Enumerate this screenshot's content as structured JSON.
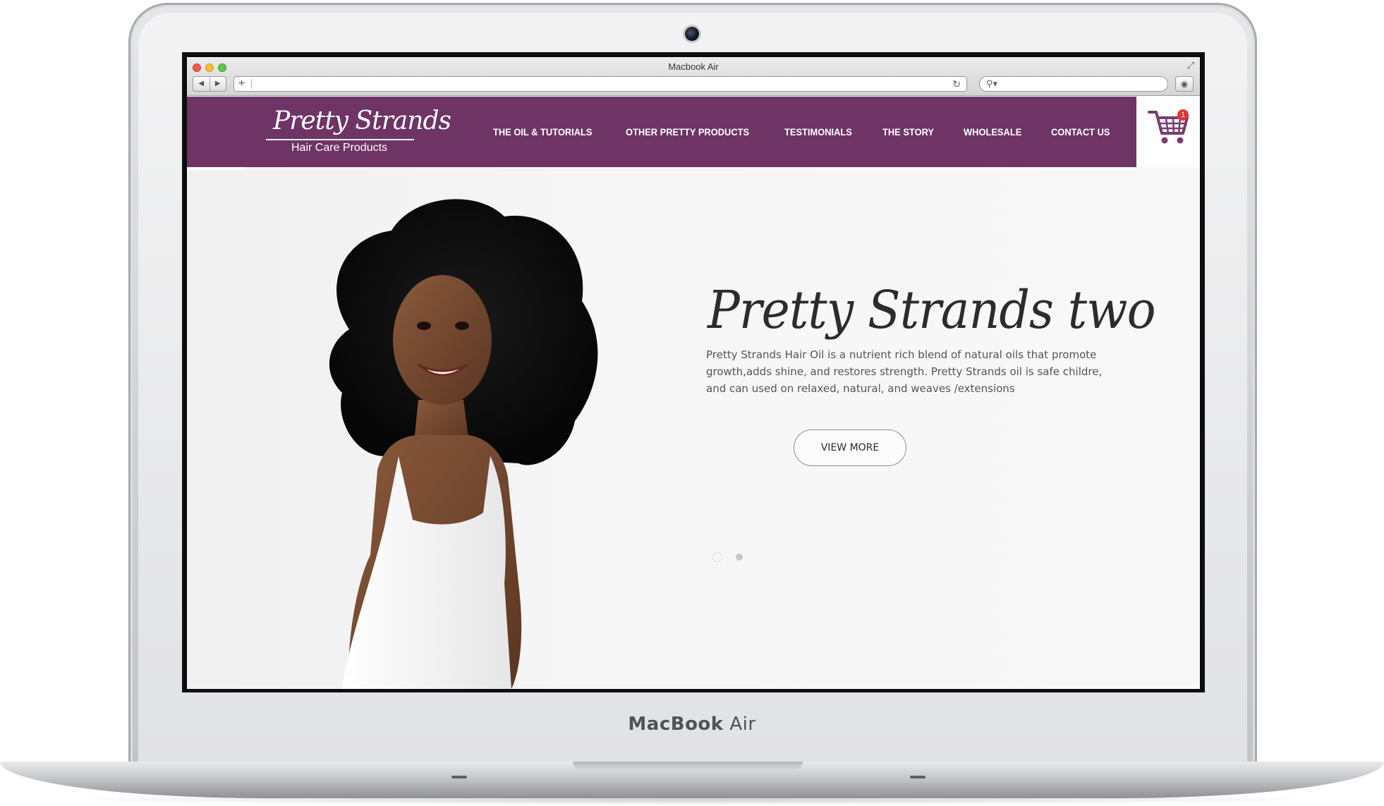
{
  "device": {
    "brand_bold": "MacBook",
    "brand_light": "Air"
  },
  "browser": {
    "window_title": "Macbook Air",
    "back_icon": "◀",
    "forward_icon": "▶",
    "new_tab_label": "+",
    "address_value": "",
    "search_value": ""
  },
  "site": {
    "logo": {
      "script": "Pretty Strands",
      "subtitle": "Hair Care Products"
    },
    "nav": [
      {
        "label": "THE OIL & TUTORIALS"
      },
      {
        "label": "OTHER PRETTY PRODUCTS"
      },
      {
        "label": "TESTIMONIALS"
      },
      {
        "label": "THE STORY"
      },
      {
        "label": "WHOLESALE"
      },
      {
        "label": "CONTACT US"
      }
    ],
    "cart": {
      "count": "1"
    },
    "colors": {
      "header_bg": "#6e3466",
      "cart_icon": "#7a3b73",
      "badge": "#e8322f"
    }
  },
  "hero": {
    "title": "Pretty Strands two",
    "description": "Pretty Strands Hair Oil is a nutrient rich blend of natural oils that promote growth,adds shine, and restores strength. Pretty Strands oil is safe childre, and can used on relaxed, natural, and weaves /extensions",
    "button_label": "VIEW MORE",
    "slides": {
      "count": 2,
      "active_index": 0
    }
  }
}
